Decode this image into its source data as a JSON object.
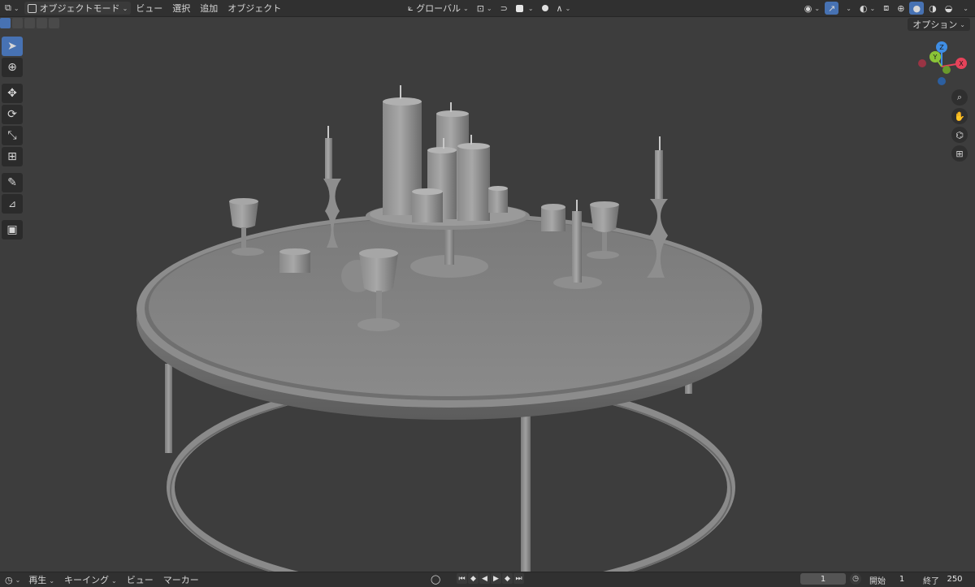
{
  "header": {
    "editor_icon": "editor-type-icon",
    "mode": "オブジェクトモード",
    "menus": [
      "ビュー",
      "選択",
      "追加",
      "オブジェクト"
    ],
    "transform_orientation": "グローバル"
  },
  "options_label": "オプション",
  "tools": [
    {
      "name": "select-box-tool",
      "glyph": "➤",
      "active": true
    },
    {
      "name": "cursor-tool",
      "glyph": "⊕",
      "active": false
    },
    {
      "name": "move-tool",
      "glyph": "✥",
      "active": false
    },
    {
      "name": "rotate-tool",
      "glyph": "⟳",
      "active": false
    },
    {
      "name": "scale-tool",
      "glyph": "⤡",
      "active": false
    },
    {
      "name": "transform-tool",
      "glyph": "⊞",
      "active": false
    },
    {
      "name": "annotate-tool",
      "glyph": "✎",
      "active": false
    },
    {
      "name": "measure-tool",
      "glyph": "📐",
      "active": false
    },
    {
      "name": "add-cube-tool",
      "glyph": "▣",
      "active": false
    }
  ],
  "gizmo": {
    "x": "X",
    "y": "Y",
    "z": "Z"
  },
  "timeline": {
    "playback": "再生",
    "keying": "キーイング",
    "view": "ビュー",
    "marker": "マーカー",
    "current_frame": "1",
    "start_label": "開始",
    "start": "1",
    "end_label": "終了",
    "end": "250"
  },
  "colors": {
    "accent": "#4772b3",
    "axis_x": "#e6435a",
    "axis_y": "#8ac437",
    "axis_z": "#3f8ee5"
  }
}
